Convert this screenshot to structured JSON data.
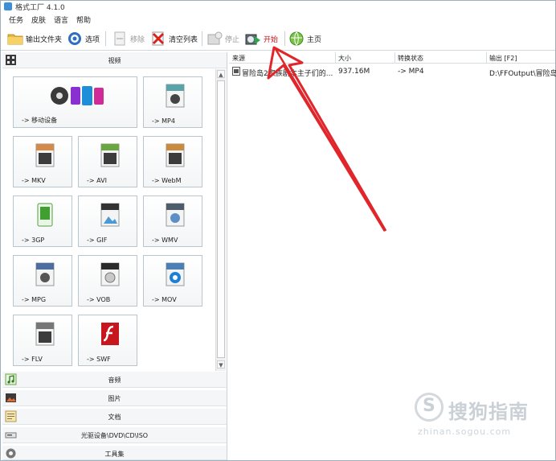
{
  "window": {
    "title": "格式工厂 4.1.0"
  },
  "menu": {
    "items": [
      "任务",
      "皮肤",
      "语言",
      "帮助"
    ]
  },
  "toolbar": {
    "output_folder": "输出文件夹",
    "options": "选项",
    "remove": "移除",
    "clear_list": "清空列表",
    "stop": "停止",
    "start": "开始",
    "home": "主页"
  },
  "categories": {
    "video": "视频",
    "audio": "音频",
    "picture": "图片",
    "document": "文档",
    "optical": "光驱设备\\DVD\\CD\\ISO",
    "tools": "工具集"
  },
  "video_formats": [
    {
      "label": "-> 移动设备",
      "badge": ""
    },
    {
      "label": "-> MP4",
      "badge": "MP4"
    },
    {
      "label": "-> MKV",
      "badge": "MKV"
    },
    {
      "label": "-> AVI",
      "badge": "AVI"
    },
    {
      "label": "-> WebM",
      "badge": "WebM"
    },
    {
      "label": "-> 3GP",
      "badge": ""
    },
    {
      "label": "-> GIF",
      "badge": "GIF"
    },
    {
      "label": "-> WMV",
      "badge": "WMV"
    },
    {
      "label": "-> MPG",
      "badge": "MPEG"
    },
    {
      "label": "-> VOB",
      "badge": "VOB"
    },
    {
      "label": "-> MOV",
      "badge": "MOV"
    },
    {
      "label": "-> FLV",
      "badge": "FLV"
    },
    {
      "label": "-> SWF",
      "badge": "SWF"
    }
  ],
  "table": {
    "columns": [
      "来源",
      "大小",
      "转换状态",
      "输出 [F2]"
    ],
    "rows": [
      {
        "source": "冒险岛2家族剧本主子们的...",
        "size": "937.16M",
        "status": "-> MP4",
        "output": "D:\\FFOutput\\冒险岛"
      }
    ]
  },
  "watermark": {
    "text": "搜狗指南",
    "sub": "zhinan.sogou.com"
  },
  "colors": {
    "accent": "#e0262b",
    "arrow": "#e0262b",
    "start_text": "#c0141a"
  }
}
